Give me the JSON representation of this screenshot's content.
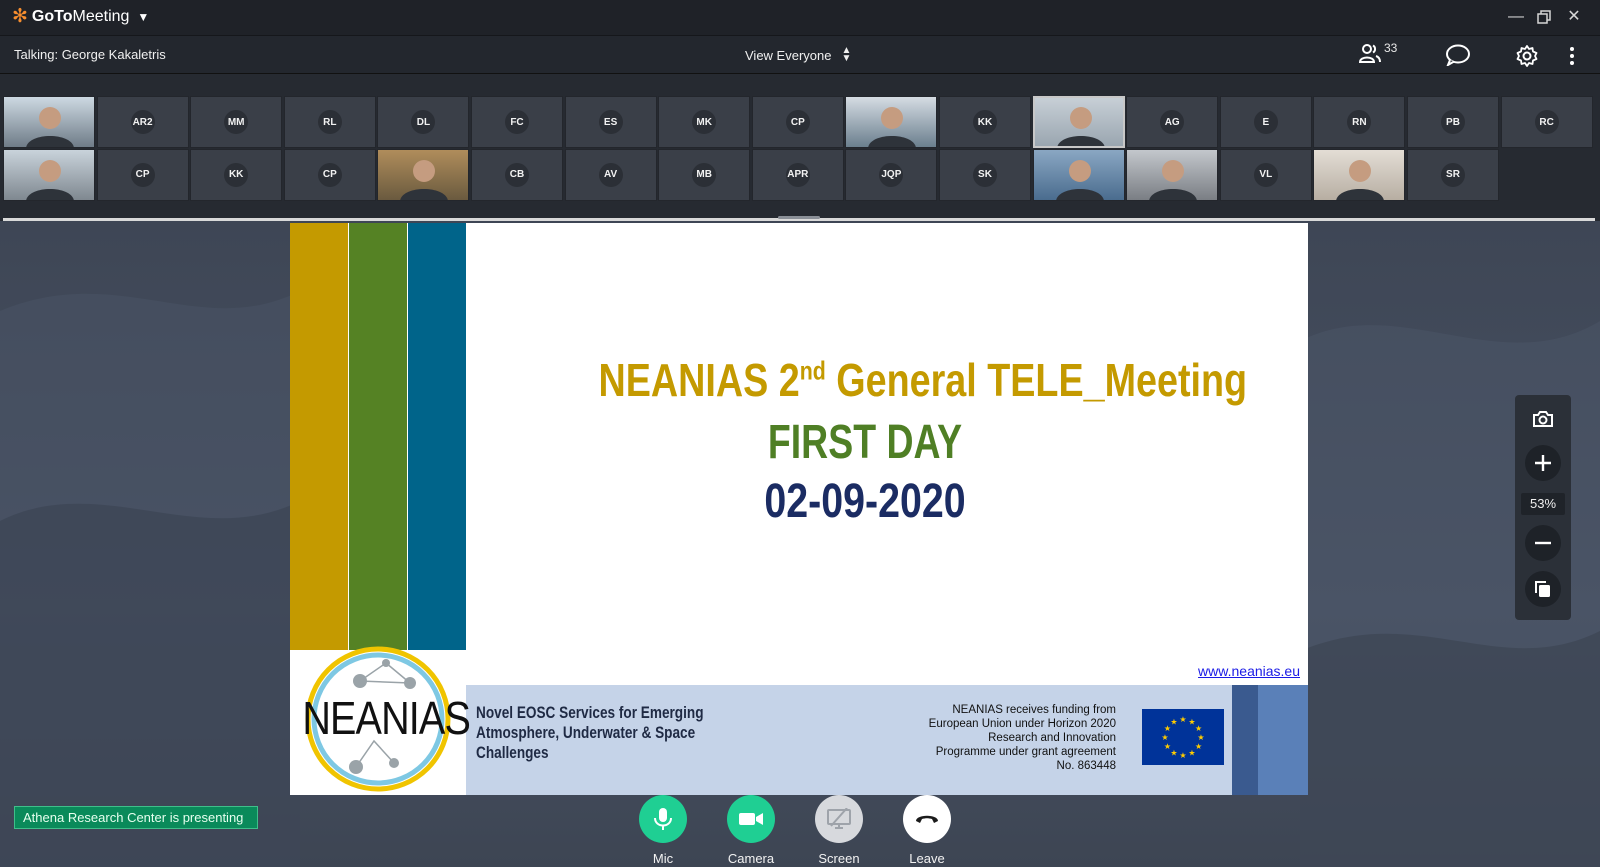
{
  "app": {
    "brand_prefix": "GoTo",
    "brand_suffix": "Meeting"
  },
  "toolbar": {
    "talking": "Talking: George Kakaletris",
    "view": "View Everyone",
    "attendee_count": "33"
  },
  "participants": {
    "row1": [
      "",
      "AR2",
      "MM",
      "RL",
      "DL",
      "FC",
      "ES",
      "MK",
      "CP",
      "",
      "KK",
      "",
      "AG",
      "E",
      "RN",
      "PB",
      "RC"
    ],
    "row2": [
      "",
      "CP",
      "KK",
      "CP",
      "",
      "CB",
      "AV",
      "MB",
      "APR",
      "JQP",
      "SK",
      "",
      "",
      "VL",
      "",
      "SR"
    ]
  },
  "slide": {
    "title_main": "NEANIAS  2",
    "title_sup": "nd",
    "title_rest": " General  TELE_Meeting",
    "subtitle": "FIRST DAY",
    "date": "02-09-2020",
    "url": "www.neanias.eu",
    "logo_word": "NEANIAS",
    "desc_lines": [
      "Novel EOSC Services for Emerging",
      "Atmosphere, Underwater & Space",
      "Challenges"
    ],
    "funding_lines": [
      "NEANIAS receives funding from",
      "European Union under Horizon 2020",
      "Research and Innovation",
      "Programme under grant agreement",
      "No. 863448"
    ],
    "bar_colors": [
      "#c49a00",
      "#558224",
      "#00648a"
    ]
  },
  "zoom": {
    "level": "53%"
  },
  "presenting": "Athena Research Center is presenting",
  "controls": {
    "mic": "Mic",
    "camera": "Camera",
    "screen": "Screen",
    "leave": "Leave"
  },
  "colors": {
    "accent_green": "#1fcf93",
    "title_gold": "#c49a00",
    "title_green": "#4f7f25",
    "title_navy": "#1b2c63"
  }
}
